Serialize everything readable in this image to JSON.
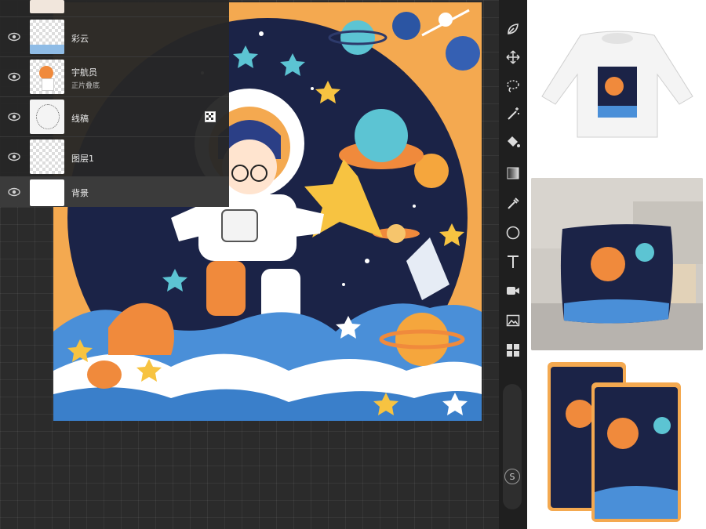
{
  "layers": [
    {
      "name": "彩云",
      "sub": "",
      "thumb": "clouds"
    },
    {
      "name": "宇航员",
      "sub": "正片叠底",
      "thumb": "astronaut"
    },
    {
      "name": "线稿",
      "sub": "",
      "thumb": "lineart"
    },
    {
      "name": "图层1",
      "sub": "",
      "thumb": "empty"
    },
    {
      "name": "背景",
      "sub": "",
      "thumb": "white"
    }
  ],
  "toolbar": {
    "tools": [
      "leaf-icon",
      "move-icon",
      "lasso-icon",
      "magic-wand-icon",
      "paint-bucket-icon",
      "gradient-icon",
      "eyedropper-icon",
      "ellipse-icon",
      "text-icon",
      "video-icon",
      "image-icon",
      "grid-icon"
    ],
    "s_label": "S"
  },
  "colors": {
    "navy": "#1b2347",
    "orange": "#f08a3c",
    "yellow": "#f7c341",
    "blue": "#3a8fd6",
    "app_bg": "#2b2b2b"
  }
}
